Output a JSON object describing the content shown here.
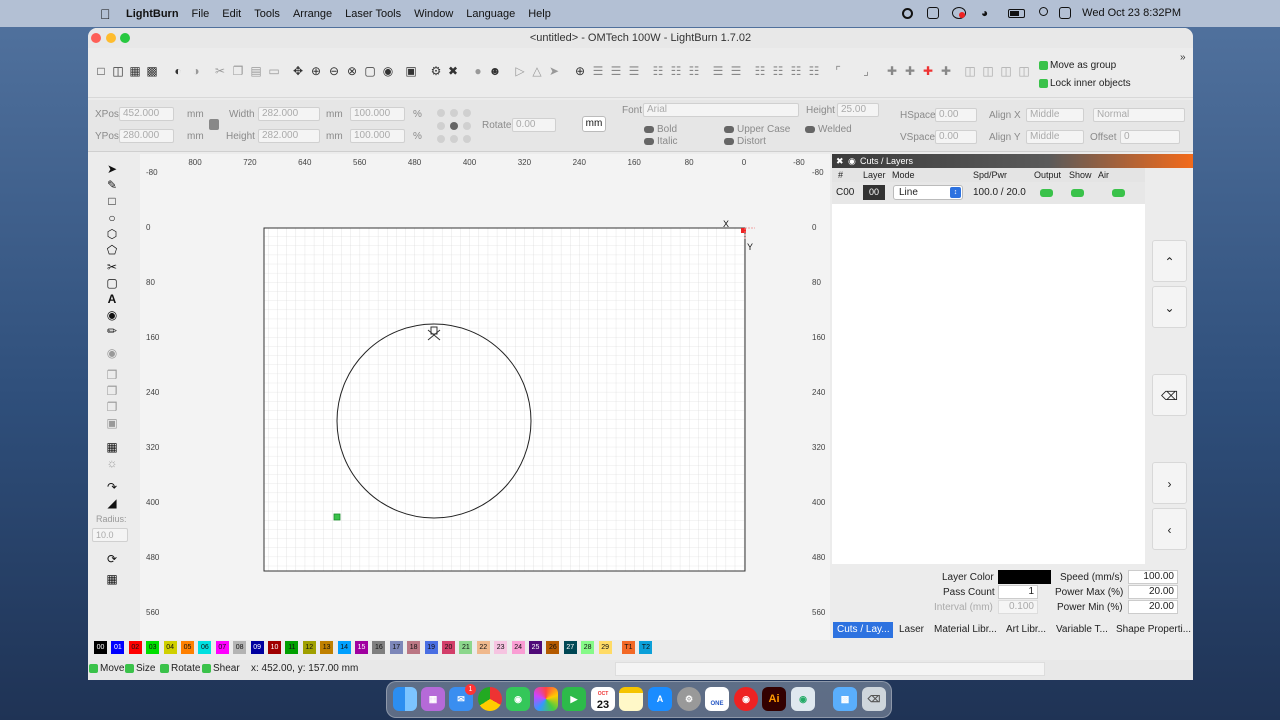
{
  "menubar": {
    "app": "LightBurn",
    "items": [
      "File",
      "Edit",
      "Tools",
      "Arrange",
      "Laser Tools",
      "Window",
      "Language",
      "Help"
    ],
    "clock": "Wed Oct 23  8:32PM"
  },
  "window": {
    "title": "<untitled> - OMTech 100W - LightBurn 1.7.02"
  },
  "toolbar": {
    "move_as_group": "Move as group",
    "lock_inner": "Lock inner objects"
  },
  "props": {
    "xpos_label": "XPos",
    "xpos": "452.000",
    "ypos_label": "YPos",
    "ypos": "280.000",
    "unit_mm": "mm",
    "width_label": "Width",
    "width": "282.000",
    "height_label": "Height",
    "height": "282.000",
    "scale_w": "100.000",
    "scale_h": "100.000",
    "pct": "%",
    "rotate_label": "Rotate",
    "rotate": "0.00",
    "unit_btn": "mm",
    "font_label": "Font",
    "font": "Arial",
    "fheight_label": "Height",
    "fheight": "25.00",
    "hspace_label": "HSpace",
    "hspace": "0.00",
    "vspace_label": "VSpace",
    "vspace": "0.00",
    "alignx_label": "Align X",
    "alignx": "Middle",
    "aligny_label": "Align Y",
    "aligny": "Middle",
    "normal": "Normal",
    "offset_label": "Offset",
    "offset": "0",
    "bold": "Bold",
    "italic": "Italic",
    "upper": "Upper Case",
    "distort": "Distort",
    "welded": "Welded"
  },
  "lefttools": {
    "radius_label": "Radius:",
    "radius": "10.0"
  },
  "ruler": {
    "top": [
      "800",
      "720",
      "640",
      "560",
      "480",
      "400",
      "320",
      "240",
      "160",
      "80",
      "0",
      "-80"
    ],
    "side": [
      "-80",
      "0",
      "80",
      "160",
      "240",
      "320",
      "400",
      "480",
      "560"
    ]
  },
  "axes": {
    "x": "X",
    "y": "Y"
  },
  "cuts": {
    "title": "Cuts / Layers",
    "headers": {
      "num": "#",
      "layer": "Layer",
      "mode": "Mode",
      "spd": "Spd/Pwr",
      "output": "Output",
      "show": "Show",
      "air": "Air"
    },
    "row": {
      "num": "C00",
      "layer": "00",
      "mode": "Line",
      "spd": "100.0 / 20.0"
    },
    "layer_color_label": "Layer Color",
    "speed_label": "Speed (mm/s)",
    "speed": "100.00",
    "pass_label": "Pass Count",
    "pass": "1",
    "pmax_label": "Power Max (%)",
    "pmax": "20.00",
    "interval_label": "Interval (mm)",
    "interval": "0.100",
    "pmin_label": "Power Min (%)",
    "pmin": "20.00",
    "tabs": [
      "Cuts / Lay...",
      "Laser",
      "Material Libr...",
      "Art Libr...",
      "Variable T...",
      "Shape Properti..."
    ]
  },
  "palette": [
    "00",
    "01",
    "02",
    "03",
    "04",
    "05",
    "06",
    "07",
    "08",
    "09",
    "10",
    "11",
    "12",
    "13",
    "14",
    "15",
    "16",
    "17",
    "18",
    "19",
    "20",
    "21",
    "22",
    "23",
    "24",
    "25",
    "26",
    "27",
    "28",
    "29",
    "T1",
    "T2"
  ],
  "palette_colors": [
    "#000000",
    "#0000ff",
    "#ff0000",
    "#00e000",
    "#d0d000",
    "#ff8000",
    "#00e0e0",
    "#ff00ff",
    "#b4b4b4",
    "#0000a0",
    "#a00000",
    "#00a000",
    "#a0a000",
    "#c08000",
    "#00a0ff",
    "#a000a0",
    "#808080",
    "#7d87b9",
    "#bb7784",
    "#4a6fe3",
    "#d33f6a",
    "#8cd78c",
    "#f0b98d",
    "#f6c4e1",
    "#fa9ed4",
    "#500a78",
    "#b45a00",
    "#004754",
    "#86fa88",
    "#ffdb66",
    "#f36926",
    "#0ca0d9"
  ],
  "status": {
    "move": "Move",
    "size": "Size",
    "rotate": "Rotate",
    "shear": "Shear",
    "coords": "x: 452.00, y: 157.00 mm"
  },
  "dock": {
    "badge": "1",
    "cal_month": "OCT",
    "cal_day": "23",
    "one": "ONE",
    "ai": "Ai"
  }
}
